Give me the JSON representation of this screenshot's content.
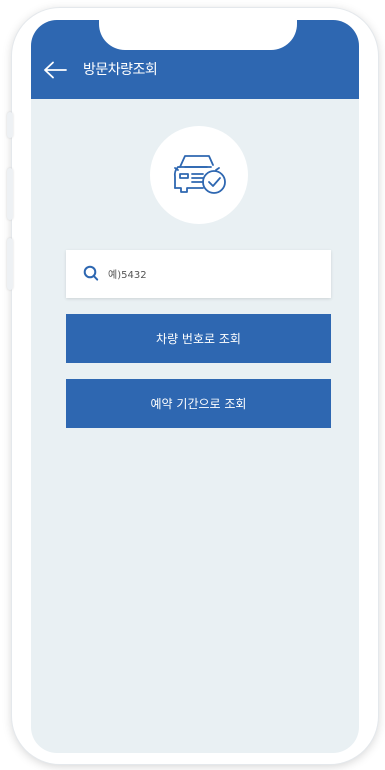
{
  "header": {
    "title": "방문차량조회",
    "back_icon": "arrow-left-icon"
  },
  "hero": {
    "icon": "car-check-icon"
  },
  "search": {
    "placeholder": "예)5432",
    "icon": "search-icon"
  },
  "buttons": {
    "by_plate": "차량 번호로 조회",
    "by_period": "예약 기간으로 조회"
  },
  "colors": {
    "primary": "#2e67b1",
    "background": "#e9f0f3",
    "surface": "#ffffff"
  }
}
